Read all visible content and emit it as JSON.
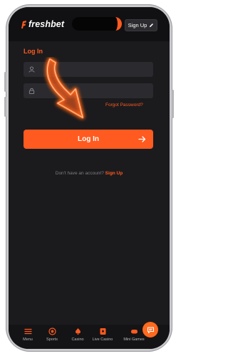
{
  "header": {
    "logo_text": "freshbet",
    "signup_label": "Sign Up"
  },
  "form": {
    "title": "Log In",
    "username_value": "",
    "password_value": "",
    "forgot_label": "Forgot Password?",
    "login_label": "Log In",
    "no_account_text": "Don't have an account?",
    "signup_link": "Sign Up"
  },
  "bottom_nav": {
    "items": [
      {
        "label": "Menu",
        "icon": "menu-icon"
      },
      {
        "label": "Sports",
        "icon": "sports-icon"
      },
      {
        "label": "Casino",
        "icon": "casino-icon"
      },
      {
        "label": "Live Casino",
        "icon": "live-casino-icon"
      },
      {
        "label": "Mini Games",
        "icon": "mini-games-icon"
      }
    ]
  },
  "colors": {
    "accent": "#ff5a1f",
    "background": "#1b1b1e",
    "field_bg": "#2a2a2f"
  }
}
